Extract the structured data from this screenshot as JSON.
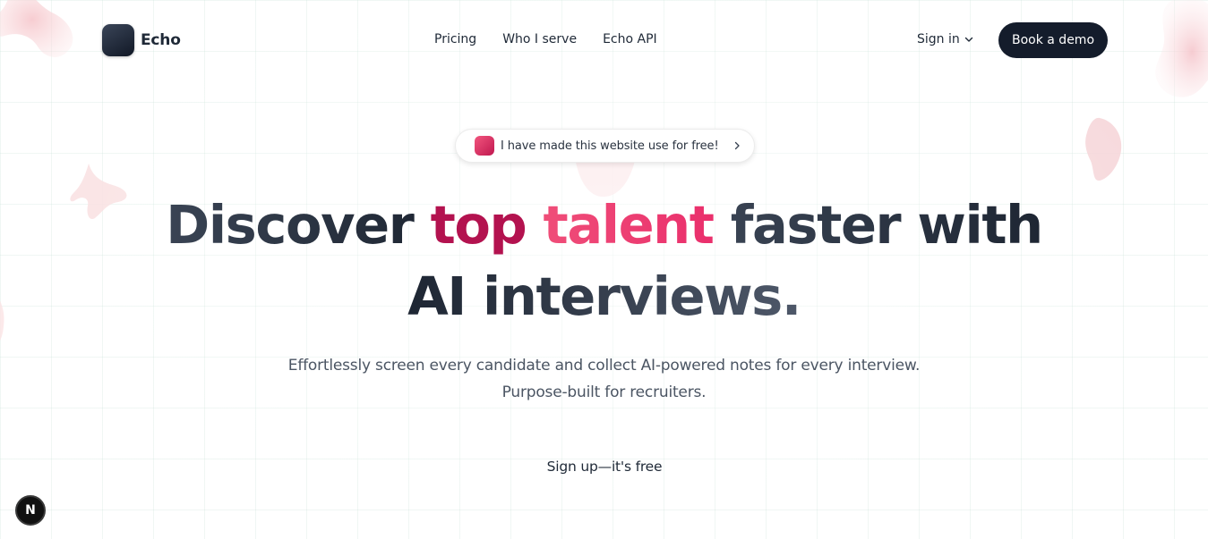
{
  "header": {
    "brand": "Echo",
    "nav": [
      {
        "label": "Pricing"
      },
      {
        "label": "Who I serve"
      },
      {
        "label": "Echo API"
      }
    ],
    "sign_in_label": "Sign in",
    "demo_label": "Book a demo"
  },
  "announcement": {
    "text": "I have made this website use for free!",
    "icon": "chevron-right-icon"
  },
  "hero": {
    "title_part1": "Discover ",
    "title_part2": "top",
    "title_part3": " talent",
    "title_part4": " faster with",
    "title_line2": "AI interviews.",
    "subtitle_line1": "Effortlessly screen every candidate and collect AI-powered notes for every interview.",
    "subtitle_line2": "Purpose-built for recruiters.",
    "cta_label": "Sign up—it's free"
  },
  "badge": {
    "label": "N"
  },
  "colors": {
    "accent_pink": "#ea2f6c",
    "accent_dark_pink": "#b3124f",
    "button_dark": "#141c2b",
    "text_dark": "#1e2633"
  }
}
